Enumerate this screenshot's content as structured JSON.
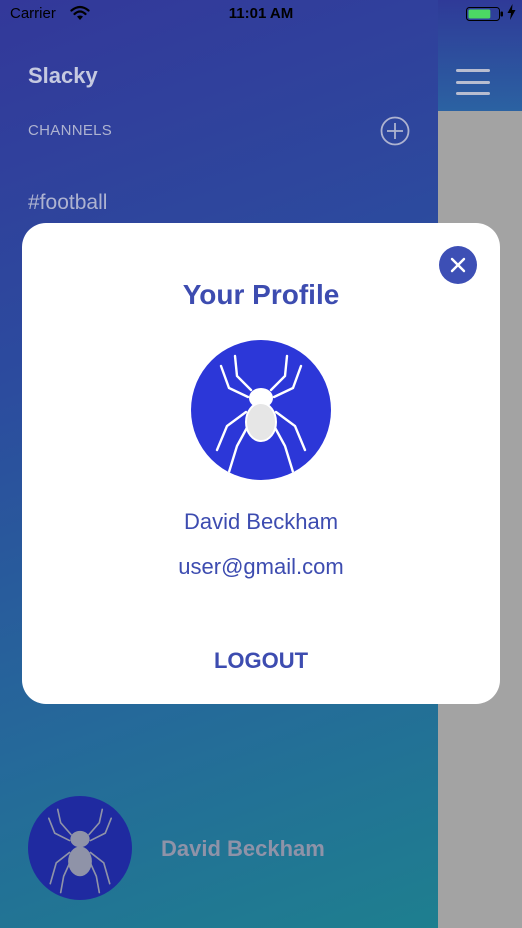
{
  "status_bar": {
    "carrier": "Carrier",
    "time": "11:01 AM",
    "battery_level": 0.75,
    "charging": true
  },
  "sidebar": {
    "app_title": "Slacky",
    "channels_label": "CHANNELS",
    "add_channel_icon": "plus-circle-icon",
    "channels": [
      {
        "label": "#football"
      }
    ],
    "user": {
      "name": "David Beckham",
      "avatar_icon": "spider-icon"
    }
  },
  "main": {
    "menu_icon": "hamburger-icon"
  },
  "profile_modal": {
    "title": "Your Profile",
    "close_icon": "close-icon",
    "avatar_icon": "spider-icon",
    "name": "David Beckham",
    "email": "user@gmail.com",
    "logout_label": "LOGOUT"
  },
  "colors": {
    "accent": "#3d4cb0",
    "avatar_bg": "#2c37d8",
    "sidebar_gradient_start": "#33389a",
    "sidebar_gradient_end": "#1e7f8f",
    "dim_overlay": "#a3a3a3"
  }
}
